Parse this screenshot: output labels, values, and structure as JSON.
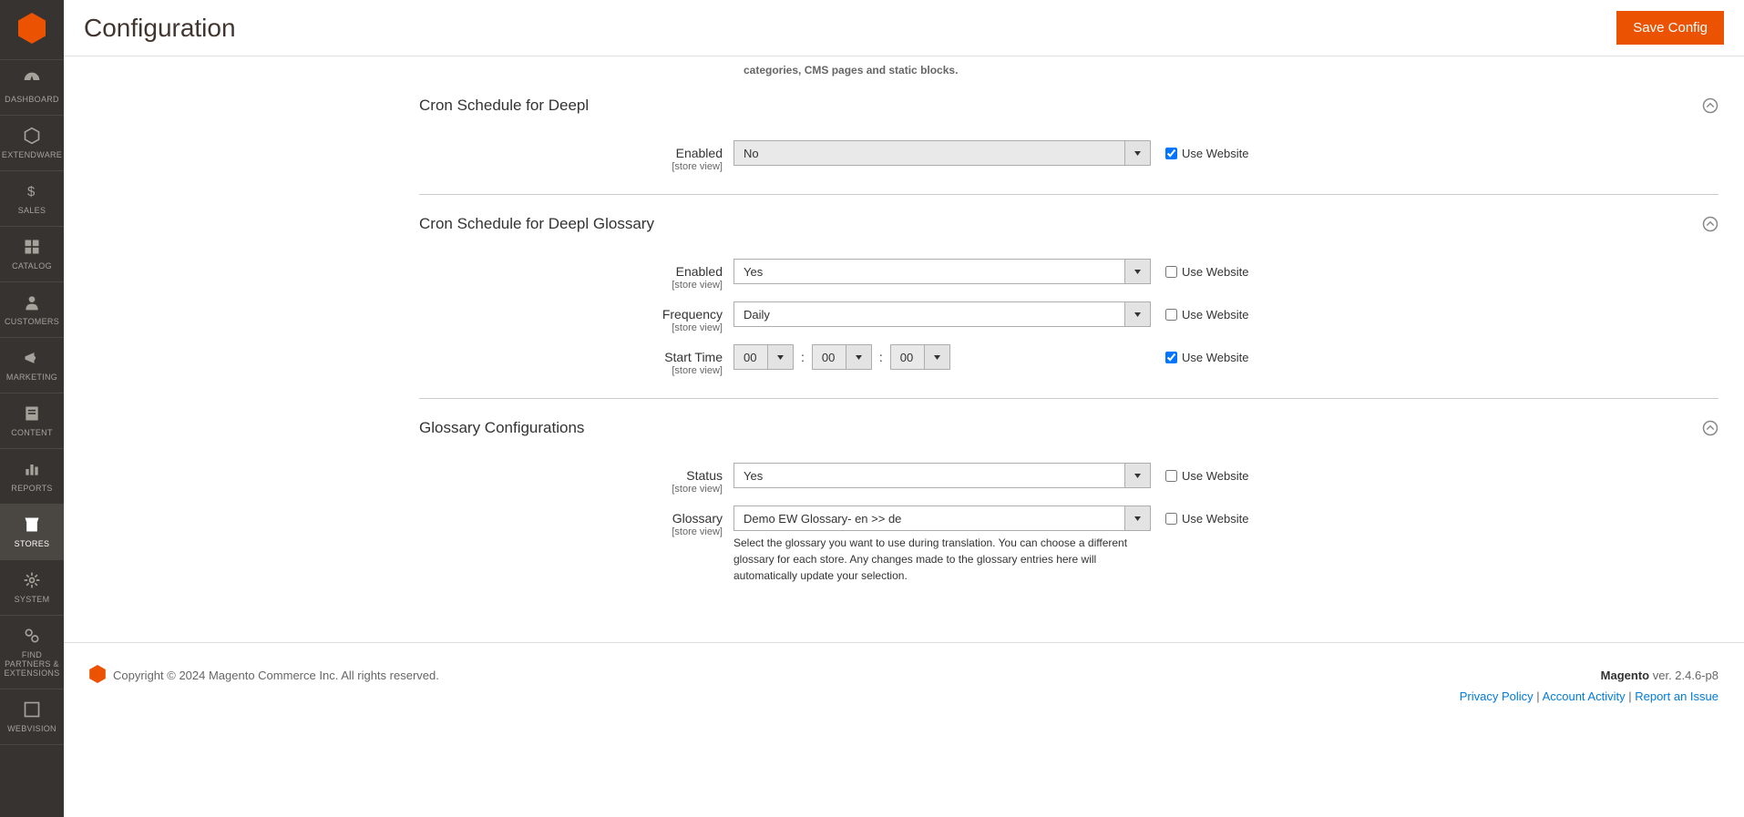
{
  "header": {
    "title": "Configuration",
    "save_label": "Save Config"
  },
  "sidebar": {
    "items": [
      {
        "label": "DASHBOARD"
      },
      {
        "label": "EXTENDWARE"
      },
      {
        "label": "SALES"
      },
      {
        "label": "CATALOG"
      },
      {
        "label": "CUSTOMERS"
      },
      {
        "label": "MARKETING"
      },
      {
        "label": "CONTENT"
      },
      {
        "label": "REPORTS"
      },
      {
        "label": "STORES"
      },
      {
        "label": "SYSTEM"
      },
      {
        "label": "FIND PARTNERS & EXTENSIONS"
      },
      {
        "label": "WEBVISION"
      }
    ]
  },
  "top_note": "categories, CMS pages and static blocks.",
  "scope_label": "[store view]",
  "use_website_label": "Use Website",
  "sections": {
    "cron_deepl": {
      "title": "Cron Schedule for Deepl",
      "enabled": {
        "label": "Enabled",
        "value": "No"
      }
    },
    "cron_glossary": {
      "title": "Cron Schedule for Deepl Glossary",
      "enabled": {
        "label": "Enabled",
        "value": "Yes"
      },
      "frequency": {
        "label": "Frequency",
        "value": "Daily"
      },
      "start_time": {
        "label": "Start Time",
        "h": "00",
        "m": "00",
        "s": "00"
      }
    },
    "glossary_cfg": {
      "title": "Glossary Configurations",
      "status": {
        "label": "Status",
        "value": "Yes"
      },
      "glossary": {
        "label": "Glossary",
        "value": "Demo EW Glossary- en >> de",
        "note": "Select the glossary you want to use during translation. You can choose a different glossary for each store. Any changes made to the glossary entries here will automatically update your selection."
      }
    }
  },
  "footer": {
    "copyright": "Copyright © 2024 Magento Commerce Inc. All rights reserved.",
    "magento_label": "Magento",
    "version": " ver. 2.4.6-p8",
    "privacy": "Privacy Policy",
    "account": " Account Activity",
    "report": "Report an Issue",
    "sep": " | "
  }
}
